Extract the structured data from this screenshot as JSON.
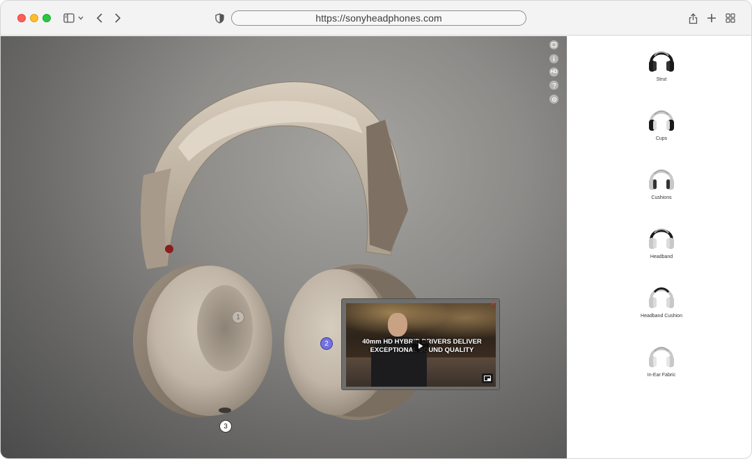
{
  "browser": {
    "url": "https://sonyheadphones.com",
    "icons": [
      "sidebar-toggle-icon",
      "chevron-down-icon",
      "back-icon",
      "forward-icon",
      "shield-icon",
      "share-icon",
      "plus-icon",
      "tabs-grid-icon"
    ]
  },
  "viewer": {
    "side_tools": [
      "fullscreen-icon",
      "info-icon",
      "hd-icon",
      "help-icon",
      "settings-icon"
    ],
    "hd_label": "HD",
    "hotspots": [
      {
        "label": "1",
        "state": "default"
      },
      {
        "label": "2",
        "state": "active"
      },
      {
        "label": "3",
        "state": "default"
      }
    ],
    "video": {
      "headline": "40mm HD HYBRID DRIVERS DELIVER EXCEPTIONAL SOUND QUALITY",
      "close_label": "×"
    }
  },
  "parts": [
    {
      "label": "Strut",
      "highlight": "strut"
    },
    {
      "label": "Cups",
      "highlight": "cups"
    },
    {
      "label": "Cushions",
      "highlight": "cushions"
    },
    {
      "label": "Headband",
      "highlight": "headband"
    },
    {
      "label": "Headband Cushion",
      "highlight": "headband-cushion"
    },
    {
      "label": "In-Ear Fabric",
      "highlight": "in-ear-fabric"
    }
  ],
  "colors": {
    "traffic_red": "#fe5f57",
    "traffic_yellow": "#febc2e",
    "traffic_green": "#28c840",
    "hotspot_active": "#7472e0",
    "video_close": "#e23b3b"
  }
}
